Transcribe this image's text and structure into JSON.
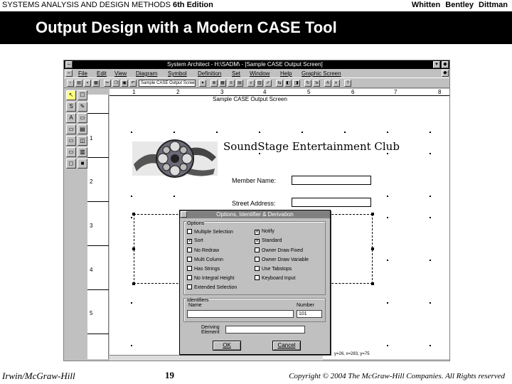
{
  "slide": {
    "header_left_title": "SYSTEMS ANALYSIS AND DESIGN METHODS",
    "header_left_edition": "6th Edition",
    "header_right": "Whitten Bentley Dittman",
    "title": "Output Design with a Modern CASE Tool",
    "footer_publisher": "Irwin/McGraw-Hill",
    "footer_page": "19",
    "footer_copyright": "Copyright © 2004 The McGraw-Hill Companies. All Rights reserved"
  },
  "window": {
    "title": "System Architect - H:\\SADM\\ - [Sample CASE Output Screen]",
    "min_label": "▾",
    "restore_label": "◆",
    "menu": [
      "File",
      "Edit",
      "View",
      "Diagram",
      "Symbol",
      "Definition",
      "Set",
      "Window",
      "Help",
      "Graphic Screen"
    ],
    "toolbar_combo": "Sample CASE Output Screen (Gr"
  },
  "palette": [
    "↖",
    "☐",
    "S",
    "✎",
    "A",
    "▭",
    "▭",
    "▤",
    "▭",
    "◫",
    "▭",
    "▥",
    "◻",
    "■"
  ],
  "ruler": {
    "vertical": [
      "1",
      "2",
      "3",
      "4",
      "5"
    ],
    "horizontal": [
      "1",
      "2",
      "3",
      "4",
      "5",
      "6",
      "7",
      "8"
    ]
  },
  "screen": {
    "caption": "Sample CASE Output Screen",
    "club_name": "SoundStage Entertainment Club",
    "member_name_label": "Member Name:",
    "street_address_label": "Street Address:",
    "coords": "y=26, x=283, y=75"
  },
  "dialog": {
    "title": "Options, Identifier & Derivation",
    "options_label": "Options",
    "options_left": [
      {
        "label": "Multiple Selection",
        "checked": false
      },
      {
        "label": "Sort",
        "checked": true
      },
      {
        "label": "No Redraw",
        "checked": false
      },
      {
        "label": "Multi Column",
        "checked": false
      },
      {
        "label": "Has Strings",
        "checked": false
      },
      {
        "label": "No Integral Height",
        "checked": false
      },
      {
        "label": "Extended Selection",
        "checked": false
      }
    ],
    "options_right": [
      {
        "label": "Notify",
        "checked": true
      },
      {
        "label": "Standard",
        "checked": true
      },
      {
        "label": "Owner Draw Fixed",
        "checked": false
      },
      {
        "label": "Owner Draw Variable",
        "checked": false
      },
      {
        "label": "Use Tabstops",
        "checked": false
      },
      {
        "label": "Keyboard Input",
        "checked": false
      }
    ],
    "identifiers_label": "Identifiers",
    "name_label": "Name",
    "number_label": "Number",
    "name_value": "",
    "number_value": "101",
    "deriving_label_1": "Deriving",
    "deriving_label_2": "Element",
    "deriving_value": "",
    "ok_label": "OK",
    "cancel_label": "Cancel"
  }
}
